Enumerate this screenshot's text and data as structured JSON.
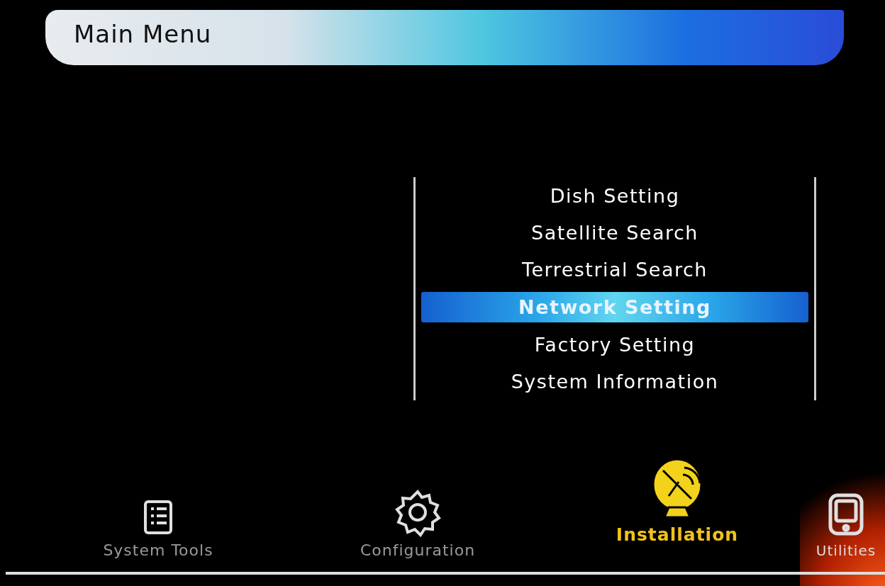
{
  "title": "Main Menu",
  "menu_items": [
    {
      "label": "Dish Setting",
      "selected": false
    },
    {
      "label": "Satellite Search",
      "selected": false
    },
    {
      "label": "Terrestrial Search",
      "selected": false
    },
    {
      "label": "Network Setting",
      "selected": true
    },
    {
      "label": "Factory Setting",
      "selected": false
    },
    {
      "label": "System Information",
      "selected": false
    }
  ],
  "categories": [
    {
      "label": "System Tools",
      "kind": "list",
      "selected": false
    },
    {
      "label": "Configuration",
      "kind": "gear",
      "selected": false
    },
    {
      "label": "Installation",
      "kind": "dish",
      "selected": true
    },
    {
      "label": "Utilities",
      "kind": "device",
      "selected": false
    }
  ]
}
